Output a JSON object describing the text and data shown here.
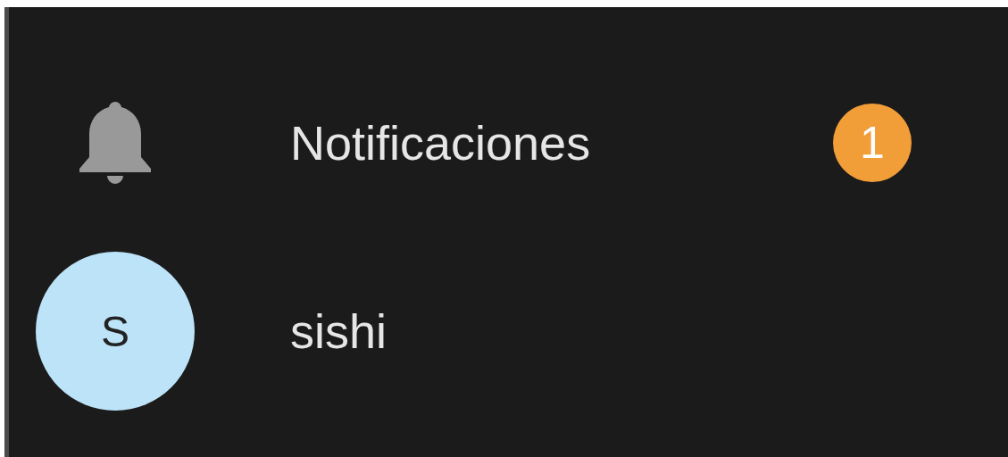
{
  "menu": {
    "items": [
      {
        "kind": "notifications",
        "label": "Notificaciones",
        "badge": "1"
      },
      {
        "kind": "user",
        "label": "sishi",
        "avatar": "S"
      }
    ]
  }
}
